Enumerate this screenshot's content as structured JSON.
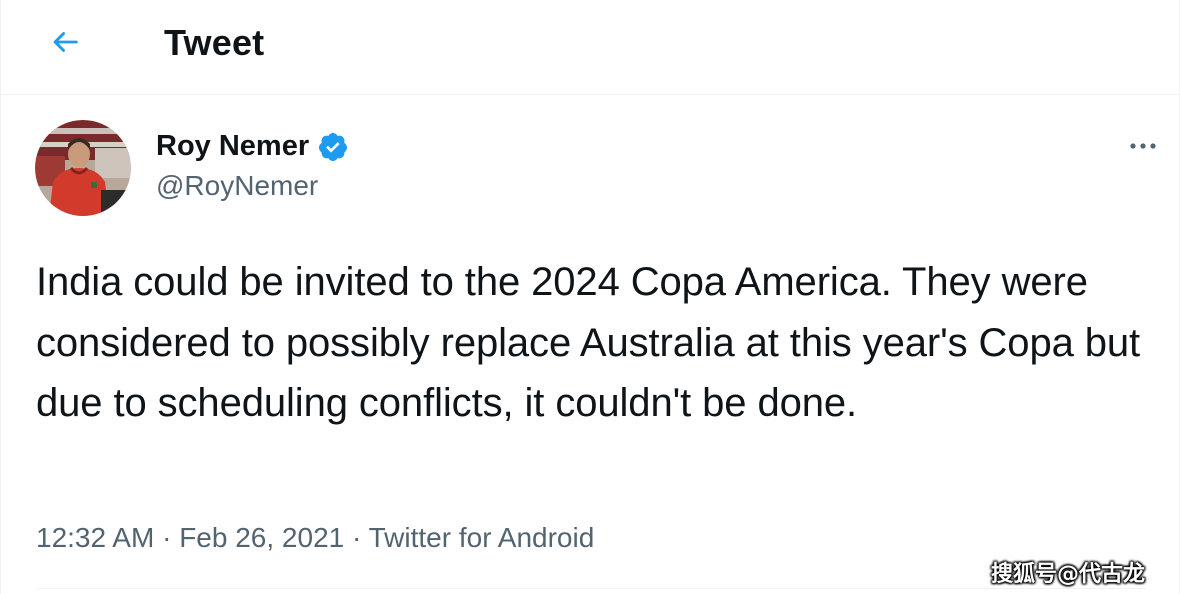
{
  "header": {
    "back_icon": "back-arrow-icon",
    "title": "Tweet"
  },
  "tweet": {
    "author": {
      "display_name": "Roy Nemer",
      "handle": "@RoyNemer",
      "verified": true,
      "avatar_icon": "user-avatar"
    },
    "more_icon": "more-options-icon",
    "text": "India could be invited to the 2024 Copa America. They were considered to possibly replace Australia at this year's Copa but due to scheduling conflicts, it couldn't be done.",
    "time": "12:32 AM",
    "separator": "·",
    "date": "Feb 26, 2021",
    "source": "Twitter for Android"
  },
  "watermark": "搜狐号@代古龙",
  "colors": {
    "accent": "#1d9bf0",
    "text_primary": "#0f1419",
    "text_secondary": "#536471",
    "border": "#eff3f4"
  }
}
